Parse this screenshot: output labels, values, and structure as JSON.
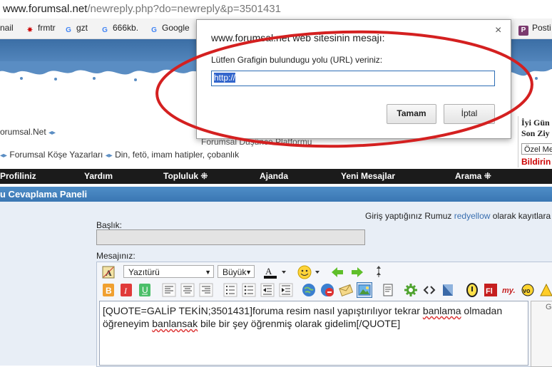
{
  "browser": {
    "url_host": "www.forumsal.net",
    "url_path": "/newreply.php?do=newreply&p=3501431",
    "bookmarks": [
      {
        "label": "nail",
        "icon": "mail-icon"
      },
      {
        "label": "frmtr",
        "icon": "frmtr-icon"
      },
      {
        "label": "gzt",
        "icon": "google-icon"
      },
      {
        "label": "666kb.",
        "icon": "google-icon"
      },
      {
        "label": "Google",
        "icon": "google-icon"
      },
      {
        "label": "Posti",
        "icon": "pocket-icon"
      }
    ]
  },
  "forum": {
    "crumb_site": "orumsal.Net",
    "crumb_path_1": "Forumsal Köşe Yazarları",
    "crumb_path_2": "Din, fetö, imam hatipler, çobanlık",
    "hidden_subtitle": "Forumsal Düşünce Platformu",
    "side_head_1": "İyi Gün",
    "side_head_2": "Son Ziy",
    "side_select": "Özel Me",
    "side_link": "Bildirin",
    "menu": [
      "Profiliniz",
      "Yardım",
      "Topluluk ⁜",
      "Ajanda",
      "Yeni Mesajlar",
      "Arama ⁜"
    ],
    "panel_title": "u Cevaplama Paneli",
    "login_info_prefix": "Giriş yaptığınız Rumuz",
    "login_user": "redyellow",
    "login_info_suffix": "olarak kayıtlara",
    "title_label": "Başlık:",
    "message_label": "Mesajınız:",
    "font_select": "Yazıtürü",
    "size_select": "Büyük",
    "message_text_1a": "[QUOTE=GALİP TEKİN;3501431]foruma resim nasıl yapıştırılıyor tekrar ",
    "message_text_1b": "banlama",
    "message_text_1c": " olmadan",
    "message_text_2a": "öğreneyim ",
    "message_text_2b": "banlansak",
    "message_text_2c": " bile bir şey öğrenmiş olarak gidelim[/QUOTE]",
    "right_label": "G"
  },
  "dialog": {
    "title": "www.forumsal.net web sitesinin mesajı:",
    "close": "×",
    "prompt": "Lütfen Grafigin bulundugu yolu (URL) veriniz:",
    "input_value": "http://",
    "ok_label": "Tamam",
    "cancel_label": "İptal"
  },
  "colors": {
    "menu_bg": "#1b1b1b",
    "panel_head": "#3a76b3",
    "annotation_ellipse": "#d42020",
    "selection": "#3366cc"
  }
}
